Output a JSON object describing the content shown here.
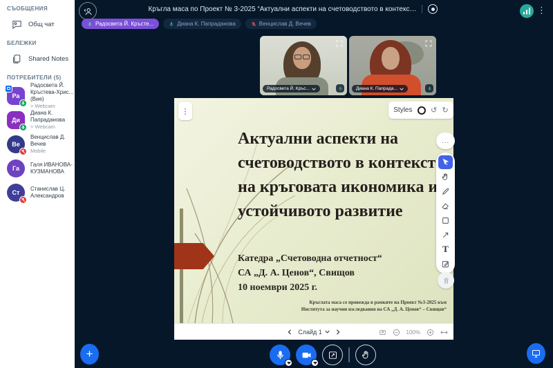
{
  "colors": {
    "accent_blue": "#1a6cf0",
    "navy_bg": "#06172a",
    "teal": "#2aa79b",
    "active_pill": "#7a50d8",
    "slide_arrow_red": "#a03418",
    "tool_active_blue": "#4262e8"
  },
  "sidebar": {
    "messages_header": "СЪОБЩЕНИЯ",
    "public_chat_label": "Общ чат",
    "notes_header": "БЕЛЕЖКИ",
    "shared_notes_label": "Shared Notes",
    "users_header": "ПОТРЕБИТЕЛИ (5)",
    "users": [
      {
        "initials": "Ра",
        "name": "Радосвета Й. Кръстева-Хрис... (Вие)",
        "sub": "> Webcam",
        "color": "#7843d0",
        "badge": "mic-on",
        "presenter": true
      },
      {
        "initials": "Ди",
        "name": "Диана К. Папраданова",
        "sub": "> Webcam",
        "color": "#8a2fc0",
        "badge": "mic-on",
        "presenter": false
      },
      {
        "initials": "Ве",
        "name": "Венцислав Д. Вечев",
        "sub": "Mobile",
        "color": "#333a8a",
        "badge": "mic-off",
        "presenter": false
      },
      {
        "initials": "Га",
        "name": "Галя ИВАНОВА-КУЗМАНОВА",
        "sub": "",
        "color": "#6f42c1",
        "badge": "none",
        "presenter": false
      },
      {
        "initials": "Ст",
        "name": "Станислав Ц. Александров",
        "sub": "",
        "color": "#3f3f9a",
        "badge": "mic-off",
        "presenter": false
      }
    ]
  },
  "topbar": {
    "title": "Кръгла маса по Проект № 3-2025 “Актуални аспекти на счетоводството в контекс…",
    "pills": [
      {
        "name": "Радосвета Й. Кръсте...",
        "state": "speaking"
      },
      {
        "name": "Диана К. Папраданова",
        "state": "idle"
      },
      {
        "name": "Венцислав Д. Вечев",
        "state": "muted"
      }
    ]
  },
  "webcams": [
    {
      "label": "Радосвета Й. Кръс..."
    },
    {
      "label": "Диана К. Папрада..."
    }
  ],
  "whiteboard": {
    "styles_label": "Styles",
    "more_label": "...",
    "kebab_label": "⋮",
    "undo_glyph": "↺",
    "redo_glyph": "↻",
    "text_tool_glyph": "T"
  },
  "slide": {
    "title_line1": "Актуални аспекти на",
    "title_line2": "счетоводството в контекста",
    "title_line3": "на кръговата икономика и",
    "title_line4": "устойчивото развитие",
    "dept_line1": "Катедра „Счетоводна отчетност“",
    "dept_line2": "СА „Д. А. Ценов“, Свищов",
    "dept_line3": "10 ноември 2025 г.",
    "footnote_line1": "Кръглата маса се провежда в рамките на Проект №3-2025 към",
    "footnote_line2": "Института за научни изследвания на СА „Д. А. Ценов“ – Свищов“"
  },
  "slide_controls": {
    "slide_label": "Слайд 1",
    "zoom_level": "100%"
  },
  "actionbar": {
    "plus_glyph": "+"
  }
}
